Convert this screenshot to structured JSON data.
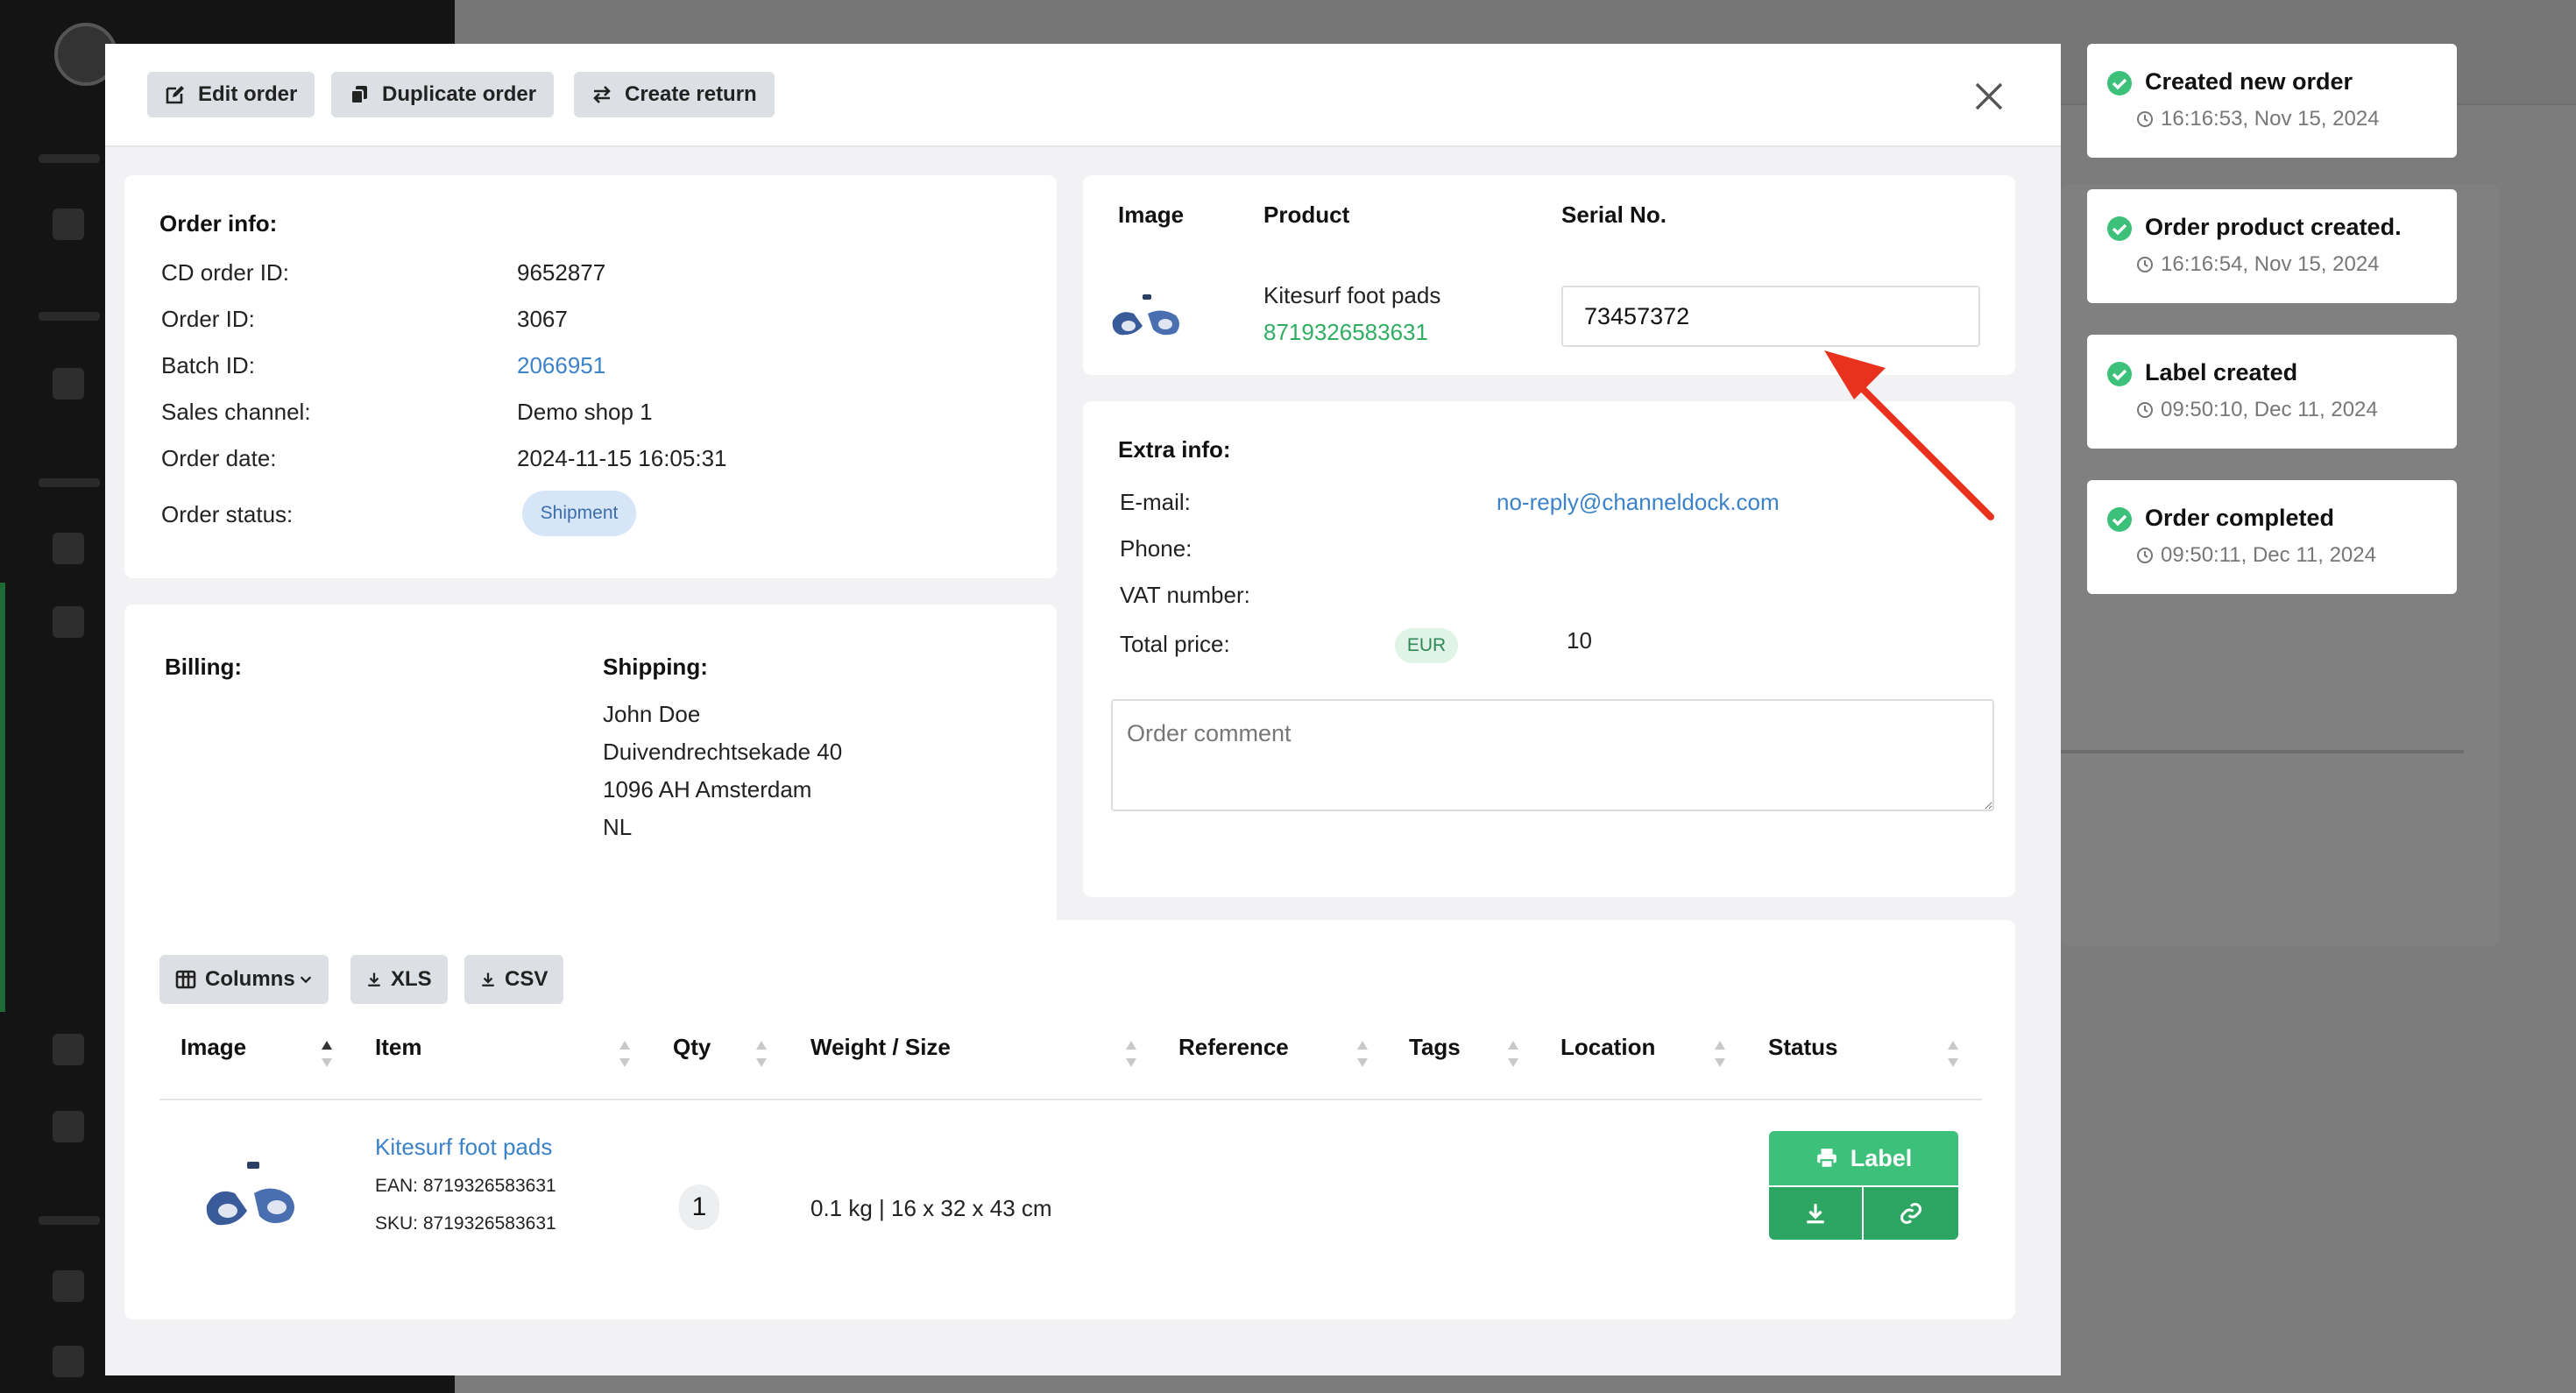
{
  "header": {
    "edit_order": "Edit order",
    "duplicate_order": "Duplicate order",
    "create_return": "Create return"
  },
  "order_info": {
    "title": "Order info:",
    "fields": [
      {
        "label": "CD order ID:",
        "value": "9652877"
      },
      {
        "label": "Order ID:",
        "value": "3067"
      },
      {
        "label": "Batch ID:",
        "value": "2066951"
      },
      {
        "label": "Sales channel:",
        "value": "Demo shop 1"
      },
      {
        "label": "Order date:",
        "value": "2024-11-15 16:05:31"
      },
      {
        "label": "Order status:",
        "value": "Shipment"
      }
    ]
  },
  "billing": {
    "title": "Billing:"
  },
  "shipping": {
    "title": "Shipping:",
    "lines": [
      "John Doe",
      "Duivendrechtsekade 40",
      "1096 AH Amsterdam",
      "NL"
    ]
  },
  "product_card": {
    "headers": {
      "image": "Image",
      "product": "Product",
      "serial": "Serial No."
    },
    "product_name": "Kitesurf foot pads",
    "product_ean": "8719326583631",
    "serial_value": "73457372"
  },
  "extra_info": {
    "title": "Extra info:",
    "fields": [
      {
        "label": "E-mail:",
        "value": "no-reply@channeldock.com"
      },
      {
        "label": "Phone:",
        "value": ""
      },
      {
        "label": "VAT number:",
        "value": ""
      },
      {
        "label": "Total price:",
        "value": "10"
      }
    ],
    "currency": "EUR",
    "comment_placeholder": "Order comment"
  },
  "table": {
    "toolbar": {
      "columns": "Columns",
      "xls": "XLS",
      "csv": "CSV"
    },
    "headers": [
      "Image",
      "Item",
      "Qty",
      "Weight / Size",
      "Reference",
      "Tags",
      "Location",
      "Status"
    ],
    "rows": [
      {
        "item": "Kitesurf foot pads",
        "ean": "EAN: 8719326583631",
        "sku": "SKU: 8719326583631",
        "qty": "1",
        "weight_size": "0.1 kg | 16 x 32 x 43 cm",
        "reference": "",
        "tags": "",
        "location": "",
        "status_button": "Label"
      }
    ]
  },
  "toasts": [
    {
      "title": "Created new order",
      "time": "16:16:53, Nov 15, 2024"
    },
    {
      "title": "Order product created.",
      "time": "16:16:54, Nov 15, 2024"
    },
    {
      "title": "Label created",
      "time": "09:50:10, Dec 11, 2024"
    },
    {
      "title": "Order completed",
      "time": "09:50:11, Dec 11, 2024"
    }
  ],
  "colors": {
    "accent_green": "#3cc07a",
    "link_blue": "#3b82c8",
    "annotation_red": "#e8321e"
  }
}
